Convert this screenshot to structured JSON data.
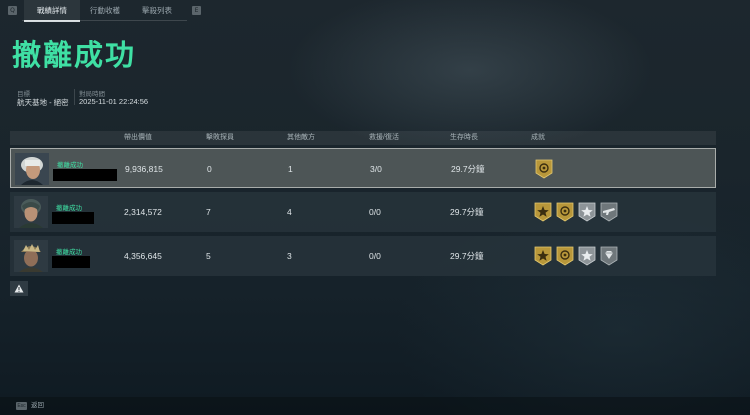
{
  "tabs": {
    "left_key": "Q",
    "right_key": "E",
    "items": [
      "戰績詳情",
      "行動收穫",
      "擊殺列表"
    ],
    "active": 0
  },
  "title": "撤離成功",
  "meta": {
    "target_label": "目標",
    "target_value": "航天基地 - 絕密",
    "time_label": "對局時間",
    "time_value": "2025-11-01 22:24:56"
  },
  "table": {
    "headers": [
      "帶出價值",
      "擊敗探員",
      "其他敵方",
      "救援/復活",
      "生存時長",
      "成就"
    ],
    "rows": [
      {
        "status": "撤離成功",
        "value": "9,936,815",
        "kills": "0",
        "other": "1",
        "rescue": "3/0",
        "time": "29.7分鐘",
        "badges": [
          "gold-medal"
        ]
      },
      {
        "status": "撤離成功",
        "value": "2,314,572",
        "kills": "7",
        "other": "4",
        "rescue": "0/0",
        "time": "29.7分鐘",
        "badges": [
          "gold-star-medal",
          "gold-medal",
          "silver-star-medal",
          "silver-gun-medal"
        ]
      },
      {
        "status": "撤離成功",
        "value": "4,356,645",
        "kills": "5",
        "other": "3",
        "rescue": "0/0",
        "time": "29.7分鐘",
        "badges": [
          "gold-star-medal",
          "gold-medal",
          "silver-star-medal",
          "silver-diamond-medal"
        ]
      }
    ]
  },
  "footer": {
    "esc_key": "Esc",
    "back_label": "返回"
  },
  "colors": {
    "accent": "#3fe0a4",
    "gold": "#b8973a",
    "silver": "#8d9498"
  }
}
